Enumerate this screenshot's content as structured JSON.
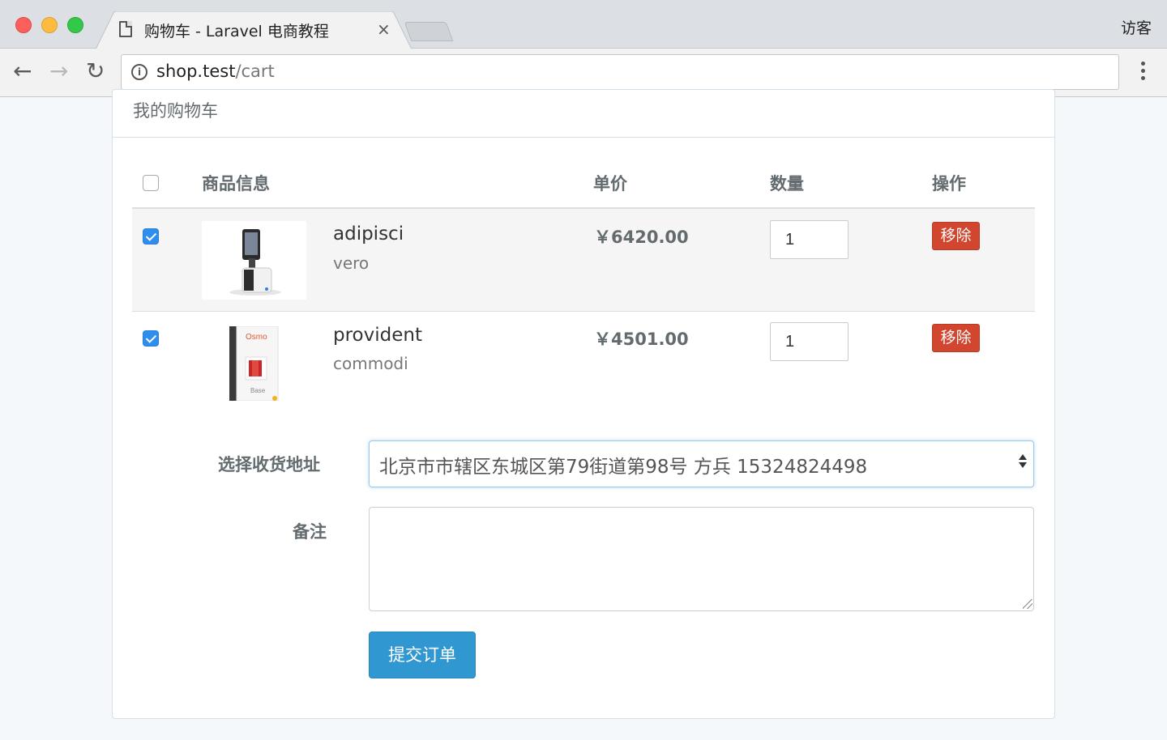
{
  "browser": {
    "tab_title": "购物车 - Laravel 电商教程",
    "tab_close": "×",
    "profile_label": "访客",
    "url_host": "shop.test",
    "url_path": "/cart",
    "icons": {
      "back": "←",
      "forward": "→",
      "reload": "↻",
      "info": "i"
    }
  },
  "page": {
    "heading": "我的购物车"
  },
  "cart_table": {
    "headers": {
      "product": "商品信息",
      "price": "单价",
      "quantity": "数量",
      "actions": "操作"
    },
    "select_all_checked": false,
    "rows": [
      {
        "checked": true,
        "title": "adipisci",
        "sku": "vero",
        "price": "￥6420.00",
        "quantity": "1",
        "remove_label": "移除",
        "thumbnail": "tablet-stand-image"
      },
      {
        "checked": true,
        "title": "provident",
        "sku": "commodi",
        "price": "￥4501.00",
        "quantity": "1",
        "remove_label": "移除",
        "thumbnail": "osmo-box-image",
        "thumbnail_brand": "Osmo",
        "thumbnail_caption": "Base"
      }
    ]
  },
  "order_form": {
    "address_label": "选择收货地址",
    "address_selected": "北京市市辖区东城区第79街道第98号 方兵 15324824498",
    "remark_label": "备注",
    "remark_value": "",
    "submit_label": "提交订单"
  },
  "colors": {
    "checkbox_checked": "#2f8eed",
    "remove_button": "#d2462f",
    "submit_button": "#3097d1",
    "select_focus_border": "#98cbe8"
  }
}
